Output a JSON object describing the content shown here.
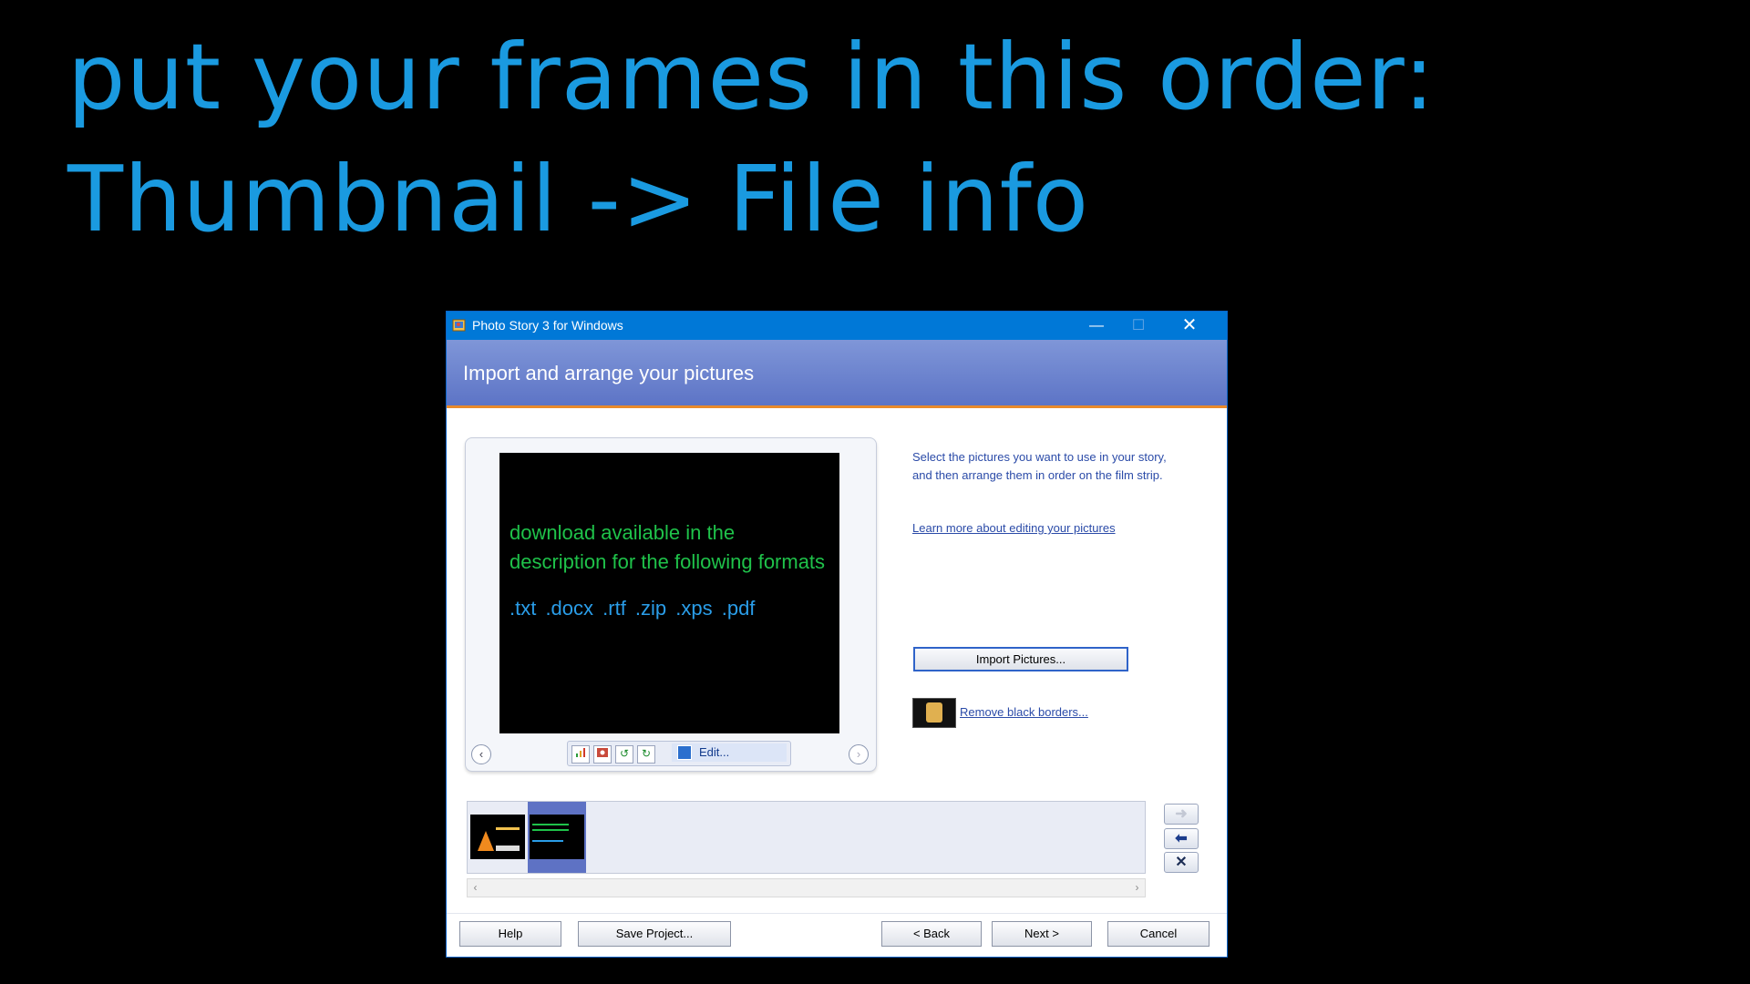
{
  "slide": {
    "title_line1": "put your frames in this order:",
    "title_line2": "Thumbnail -> File info"
  },
  "window": {
    "title": "Photo Story 3 for Windows",
    "minimize_glyph": "—",
    "maximize_glyph": "☐",
    "close_glyph": "✕"
  },
  "header": {
    "title": "Import and arrange your pictures"
  },
  "preview": {
    "line1": "download available in the",
    "line2": "description for the following formats",
    "formats": ".txt  .docx  .rtf  .zip  .xps  .pdf",
    "prev_glyph": "‹",
    "next_glyph": "›",
    "edit_label": "Edit..."
  },
  "instructions": {
    "text": "Select the pictures you want to use in your story, and then arrange them in order on the film strip.",
    "learn_link": "Learn more about editing your pictures"
  },
  "actions": {
    "import_label": "Import Pictures...",
    "remove_borders_label": "Remove black borders..."
  },
  "filmstrip": {
    "scroll_left": "‹",
    "scroll_right": "›",
    "move_right_glyph": "➜",
    "move_left_glyph": "⬅",
    "delete_glyph": "✕"
  },
  "footer": {
    "help": "Help",
    "save_project": "Save Project...",
    "back": "< Back",
    "next": "Next >",
    "cancel": "Cancel"
  },
  "colors": {
    "slide_title": "#1a9ae0",
    "titlebar": "#0078d7",
    "header": "#5d74c6",
    "accent_orange": "#e98a2c",
    "link_blue": "#2b4ba8",
    "preview_green": "#1fc24a",
    "preview_blue": "#2a9de8"
  }
}
